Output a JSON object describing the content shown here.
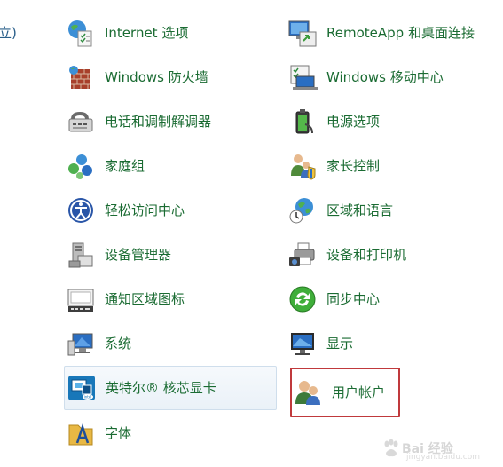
{
  "cut_off_text": "立)",
  "left_column": [
    {
      "label": "Internet 选项",
      "icon": "internet-options-icon"
    },
    {
      "label": "Windows 防火墙",
      "icon": "firewall-icon"
    },
    {
      "label": "电话和调制解调器",
      "icon": "phone-modem-icon"
    },
    {
      "label": "家庭组",
      "icon": "homegroup-icon"
    },
    {
      "label": "轻松访问中心",
      "icon": "ease-of-access-icon"
    },
    {
      "label": "设备管理器",
      "icon": "device-manager-icon"
    },
    {
      "label": "通知区域图标",
      "icon": "notification-area-icon"
    },
    {
      "label": "系统",
      "icon": "system-icon"
    },
    {
      "label": "英特尔® 核芯显卡",
      "icon": "intel-graphics-icon"
    },
    {
      "label": "字体",
      "icon": "fonts-icon"
    }
  ],
  "right_column": [
    {
      "label": "RemoteApp 和桌面连接",
      "icon": "remoteapp-icon"
    },
    {
      "label": "Windows 移动中心",
      "icon": "mobility-center-icon"
    },
    {
      "label": "电源选项",
      "icon": "power-options-icon"
    },
    {
      "label": "家长控制",
      "icon": "parental-controls-icon"
    },
    {
      "label": "区域和语言",
      "icon": "region-language-icon"
    },
    {
      "label": "设备和打印机",
      "icon": "devices-printers-icon"
    },
    {
      "label": "同步中心",
      "icon": "sync-center-icon"
    },
    {
      "label": "显示",
      "icon": "display-icon"
    },
    {
      "label": "用户帐户",
      "icon": "user-accounts-icon"
    }
  ],
  "watermark": {
    "text": "Bai 经验",
    "sub": "jingyan.baidu.com"
  },
  "colors": {
    "link_text": "#1a6b32",
    "highlight_border": "#c0393c",
    "hover_bg": "#eaf1f8"
  }
}
